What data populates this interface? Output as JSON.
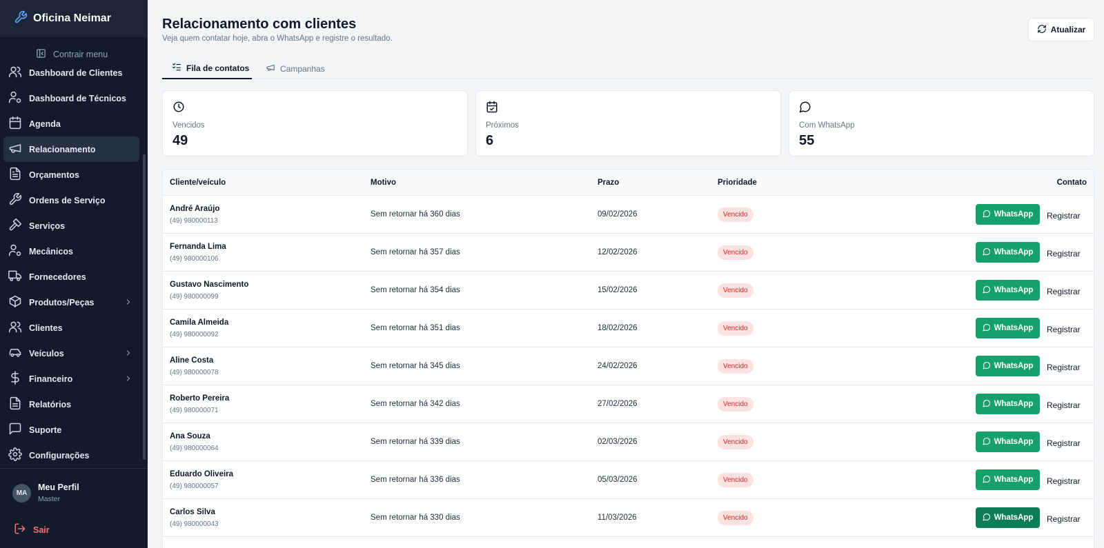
{
  "app": {
    "name": "Oficina Neimar"
  },
  "sidebar": {
    "collapse_label": "Contrair menu",
    "items": [
      {
        "label": "Dashboard de Clientes",
        "icon": "users-icon"
      },
      {
        "label": "Dashboard de Técnicos",
        "icon": "user-gear-icon"
      },
      {
        "label": "Agenda",
        "icon": "calendar-icon"
      },
      {
        "label": "Relacionamento",
        "icon": "megaphone-icon",
        "active": true
      },
      {
        "label": "Orçamentos",
        "icon": "document-icon"
      },
      {
        "label": "Ordens de Serviço",
        "icon": "wrench-icon"
      },
      {
        "label": "Serviços",
        "icon": "hammer-icon"
      },
      {
        "label": "Mecânicos",
        "icon": "user-gear-icon"
      },
      {
        "label": "Fornecedores",
        "icon": "truck-icon"
      },
      {
        "label": "Produtos/Peças",
        "icon": "box-icon",
        "expandable": true
      },
      {
        "label": "Clientes",
        "icon": "users-icon"
      },
      {
        "label": "Veículos",
        "icon": "car-icon",
        "expandable": true
      },
      {
        "label": "Financeiro",
        "icon": "dollar-icon",
        "expandable": true
      },
      {
        "label": "Relatórios",
        "icon": "report-icon"
      },
      {
        "label": "Suporte",
        "icon": "chat-icon"
      },
      {
        "label": "Configurações",
        "icon": "gear-icon"
      }
    ],
    "profile": {
      "initials": "MA",
      "name": "Meu Perfil",
      "role": "Master"
    },
    "logout_label": "Sair"
  },
  "header": {
    "title": "Relacionamento com clientes",
    "subtitle": "Veja quem contatar hoje, abra o WhatsApp e registre o resultado.",
    "refresh_label": "Atualizar"
  },
  "tabs": [
    {
      "label": "Fila de contatos",
      "active": true
    },
    {
      "label": "Campanhas",
      "active": false
    }
  ],
  "stats": [
    {
      "label": "Vencidos",
      "value": "49",
      "icon": "clock-icon"
    },
    {
      "label": "Próximos",
      "value": "6",
      "icon": "calendar-check-icon"
    },
    {
      "label": "Com WhatsApp",
      "value": "55",
      "icon": "chat-bubble-icon"
    }
  ],
  "table": {
    "headers": {
      "client": "Cliente/veículo",
      "reason": "Motivo",
      "deadline": "Prazo",
      "priority": "Prioridade",
      "contact": "Contato"
    },
    "whatsapp_label": "WhatsApp",
    "register_label": "Registrar",
    "rows": [
      {
        "name": "André Araújo",
        "phone": "(49) 980000113",
        "reason": "Sem retornar há 360 dias",
        "deadline": "09/02/2026",
        "priority": "Vencido"
      },
      {
        "name": "Fernanda Lima",
        "phone": "(49) 980000106",
        "reason": "Sem retornar há 357 dias",
        "deadline": "12/02/2026",
        "priority": "Vencido"
      },
      {
        "name": "Gustavo Nascimento",
        "phone": "(49) 980000099",
        "reason": "Sem retornar há 354 dias",
        "deadline": "15/02/2026",
        "priority": "Vencido"
      },
      {
        "name": "Camila Almeida",
        "phone": "(49) 980000092",
        "reason": "Sem retornar há 351 dias",
        "deadline": "18/02/2026",
        "priority": "Vencido"
      },
      {
        "name": "Aline Costa",
        "phone": "(49) 980000078",
        "reason": "Sem retornar há 345 dias",
        "deadline": "24/02/2026",
        "priority": "Vencido"
      },
      {
        "name": "Roberto Pereira",
        "phone": "(49) 980000071",
        "reason": "Sem retornar há 342 dias",
        "deadline": "27/02/2026",
        "priority": "Vencido"
      },
      {
        "name": "Ana Souza",
        "phone": "(49) 980000064",
        "reason": "Sem retornar há 339 dias",
        "deadline": "02/03/2026",
        "priority": "Vencido"
      },
      {
        "name": "Eduardo Oliveira",
        "phone": "(49) 980000057",
        "reason": "Sem retornar há 336 dias",
        "deadline": "05/03/2026",
        "priority": "Vencido"
      },
      {
        "name": "Carlos Silva",
        "phone": "(49) 980000043",
        "reason": "Sem retornar há 330 dias",
        "deadline": "11/03/2026",
        "priority": "Vencido"
      }
    ]
  },
  "colors": {
    "sidebar": "#121b2b",
    "whatsapp": "#16a06b",
    "badge_bg": "#fde2e2",
    "badge_text": "#dc2626"
  }
}
